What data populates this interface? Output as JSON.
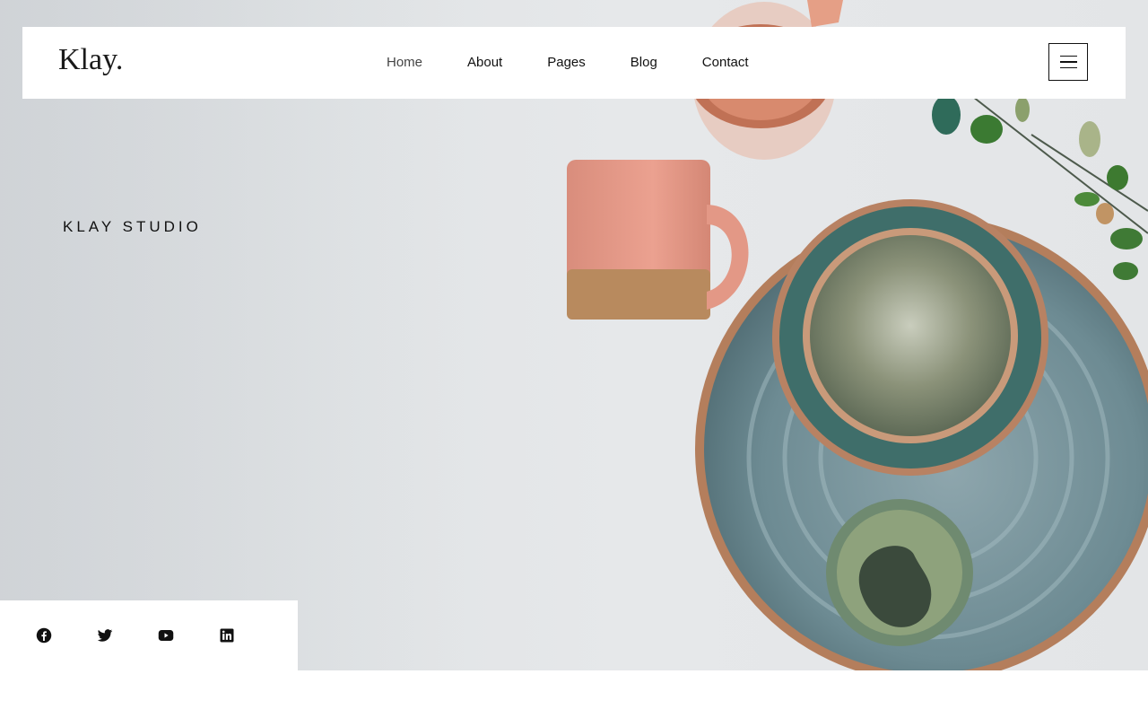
{
  "brand": {
    "logo": "Klay."
  },
  "nav": {
    "items": [
      {
        "label": "Home",
        "active": true
      },
      {
        "label": "About"
      },
      {
        "label": "Pages"
      },
      {
        "label": "Blog"
      },
      {
        "label": "Contact"
      }
    ],
    "menu_icon": "hamburger-menu-icon"
  },
  "hero": {
    "eyebrow": "KLAY STUDIO"
  },
  "social": {
    "icons": [
      "facebook-icon",
      "twitter-icon",
      "youtube-icon",
      "linkedin-icon"
    ]
  },
  "colors": {
    "background": "#e3e5e7",
    "text": "#111111",
    "header_bg": "#ffffff"
  }
}
